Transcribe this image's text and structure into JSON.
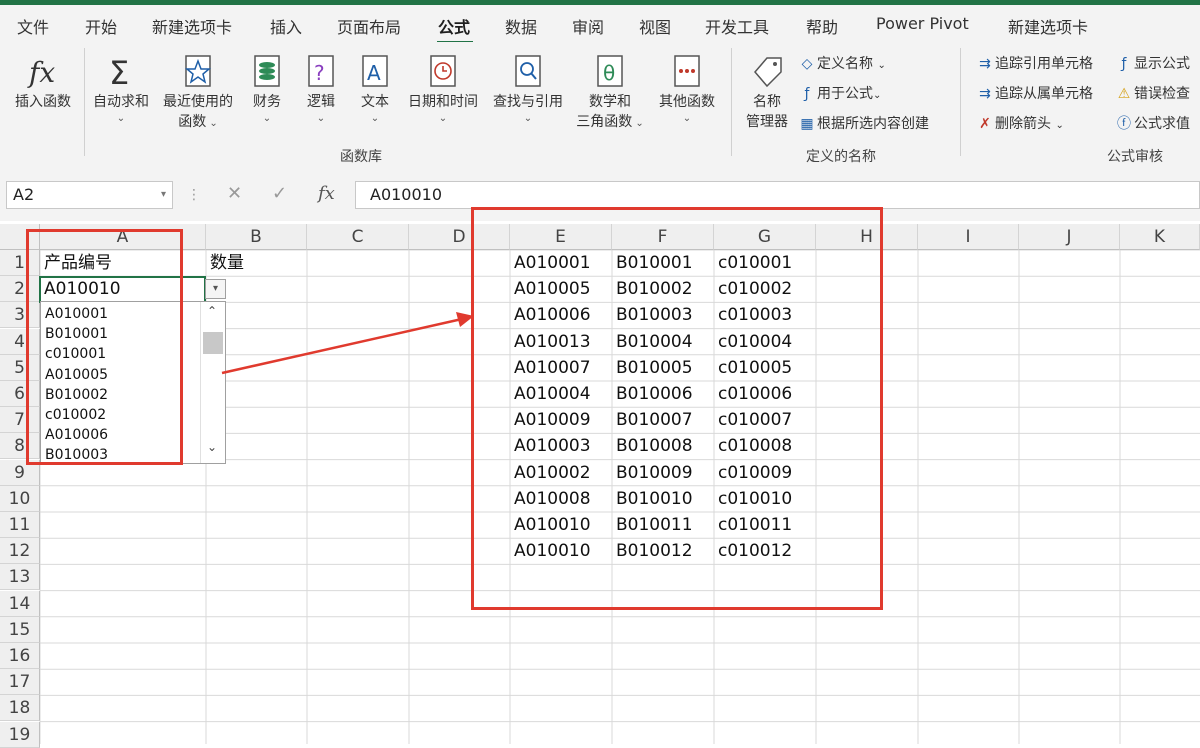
{
  "menu": {
    "items": [
      "文件",
      "开始",
      "新建选项卡",
      "插入",
      "页面布局",
      "公式",
      "数据",
      "审阅",
      "视图",
      "开发工具",
      "帮助",
      "Power Pivot",
      "新建选项卡"
    ],
    "active": "公式"
  },
  "ribbon": {
    "insert_function": "插入函数",
    "autosum": "自动求和",
    "recent_1": "最近使用的",
    "recent_2": "函数",
    "financial": "财务",
    "logical": "逻辑",
    "text": "文本",
    "datetime": "日期和时间",
    "lookup": "查找与引用",
    "math_1": "数学和",
    "math_2": "三角函数",
    "more": "其他函数",
    "group_library": "函数库",
    "name_mgr_1": "名称",
    "name_mgr_2": "管理器",
    "define_name": "定义名称",
    "use_in_formula": "用于公式",
    "create_from_sel": "根据所选内容创建",
    "group_names": "定义的名称",
    "trace_precedents": "追踪引用单元格",
    "trace_dependents": "追踪从属单元格",
    "remove_arrows": "删除箭头",
    "show_formulas": "显示公式",
    "error_check": "错误检查",
    "evaluate": "公式求值",
    "group_audit": "公式审核"
  },
  "formula_bar": {
    "name_box": "A2",
    "fx": "fx",
    "content": "A010010"
  },
  "columns": [
    "A",
    "B",
    "C",
    "D",
    "E",
    "F",
    "G",
    "H",
    "I",
    "J",
    "K"
  ],
  "rows": [
    "1",
    "2",
    "3",
    "4",
    "5",
    "6",
    "7",
    "8",
    "9",
    "10",
    "11",
    "12",
    "13",
    "14",
    "15",
    "16",
    "17",
    "18",
    "19"
  ],
  "cells": {
    "a1": "产品编号",
    "b1": "数量",
    "a2": "A010010",
    "e": [
      "A010001",
      "A010005",
      "A010006",
      "A010013",
      "A010007",
      "A010004",
      "A010009",
      "A010003",
      "A010002",
      "A010008",
      "A010010",
      "A010010"
    ],
    "f": [
      "B010001",
      "B010002",
      "B010003",
      "B010004",
      "B010005",
      "B010006",
      "B010007",
      "B010008",
      "B010009",
      "B010010",
      "B010011",
      "B010012"
    ],
    "g": [
      "c010001",
      "c010002",
      "c010003",
      "c010004",
      "c010005",
      "c010006",
      "c010007",
      "c010008",
      "c010009",
      "c010010",
      "c010011",
      "c010012"
    ]
  },
  "dropdown": {
    "items": [
      "A010001",
      "B010001",
      "c010001",
      "A010005",
      "B010002",
      "c010002",
      "A010006",
      "B010003"
    ]
  },
  "colors": {
    "accent": "#217346",
    "annotation": "#e03a2e"
  }
}
